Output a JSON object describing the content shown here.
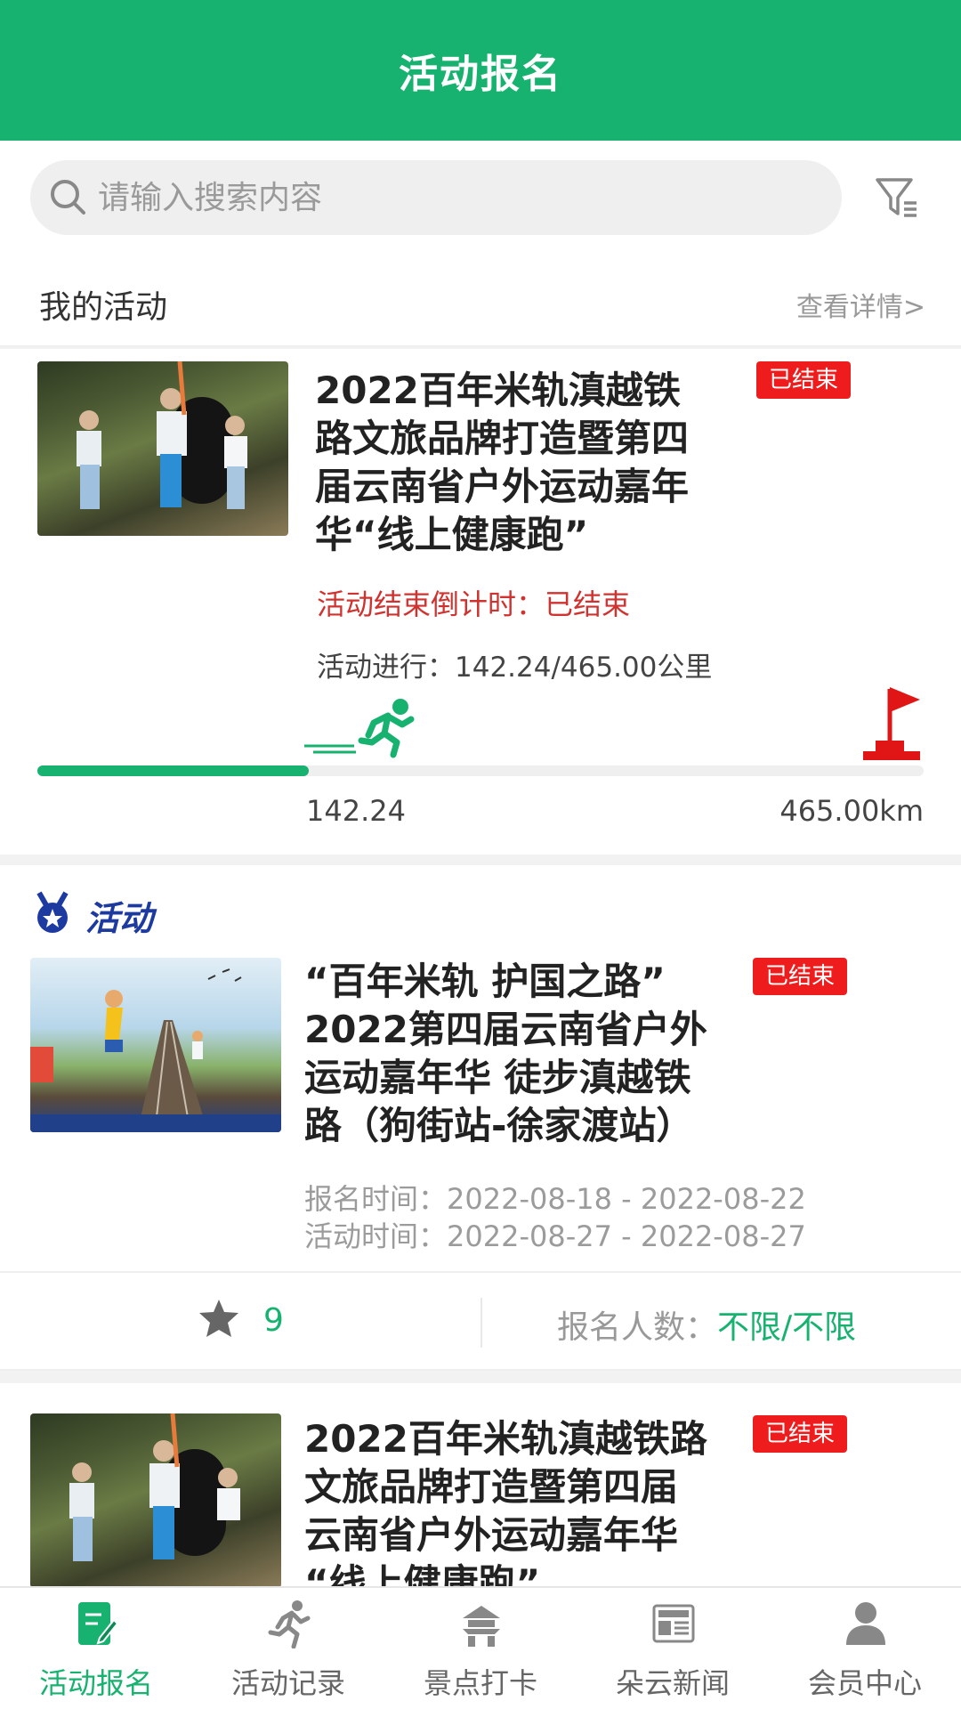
{
  "header": {
    "title": "活动报名"
  },
  "search": {
    "placeholder": "请输入搜索内容",
    "icon": "search-icon",
    "filter_icon": "filter-icon"
  },
  "my_activity": {
    "label": "我的活动",
    "more": "查看详情>",
    "card": {
      "status": "已结束",
      "title_lines": [
        "2022百年米轨滇越铁",
        "路文旅品牌打造暨第四",
        "届云南省户外运动嘉年",
        "华“线上健康跑”"
      ],
      "countdown": "活动结束倒计时：已结束",
      "progress_text": "活动进行：142.24/465.00公里",
      "progress_fraction": 0.306,
      "start_value": "142.24",
      "end_value": "465.00km"
    }
  },
  "activities": {
    "label": "活动",
    "item1": {
      "status": "已结束",
      "title_lines": [
        "“百年米轨  护国之路”",
        "2022第四届云南省户外",
        "运动嘉年华 徒步滇越铁",
        "路（狗街站-徐家渡站）"
      ],
      "signup_time": "报名时间：2022-08-18 - 2022-08-22",
      "event_time": "活动时间：2022-08-27 - 2022-08-27",
      "favorites": "9",
      "enroll_label": "报名人数：",
      "enroll_value": "不限/不限"
    },
    "item2": {
      "status": "已结束",
      "title_lines": [
        "2022百年米轨滇越铁路",
        "文旅品牌打造暨第四届",
        "云南省户外运动嘉年华",
        "“线上健康跑”"
      ]
    }
  },
  "tabs": [
    {
      "label": "活动报名",
      "icon": "edit-doc-icon",
      "active": true
    },
    {
      "label": "活动记录",
      "icon": "runner-icon",
      "active": false
    },
    {
      "label": "景点打卡",
      "icon": "pagoda-icon",
      "active": false
    },
    {
      "label": "朵云新闻",
      "icon": "news-icon",
      "active": false
    },
    {
      "label": "会员中心",
      "icon": "user-icon",
      "active": false
    }
  ],
  "colors": {
    "brand": "#17b26f",
    "status_end": "#ee1c1c",
    "countdown": "#d0322f"
  }
}
